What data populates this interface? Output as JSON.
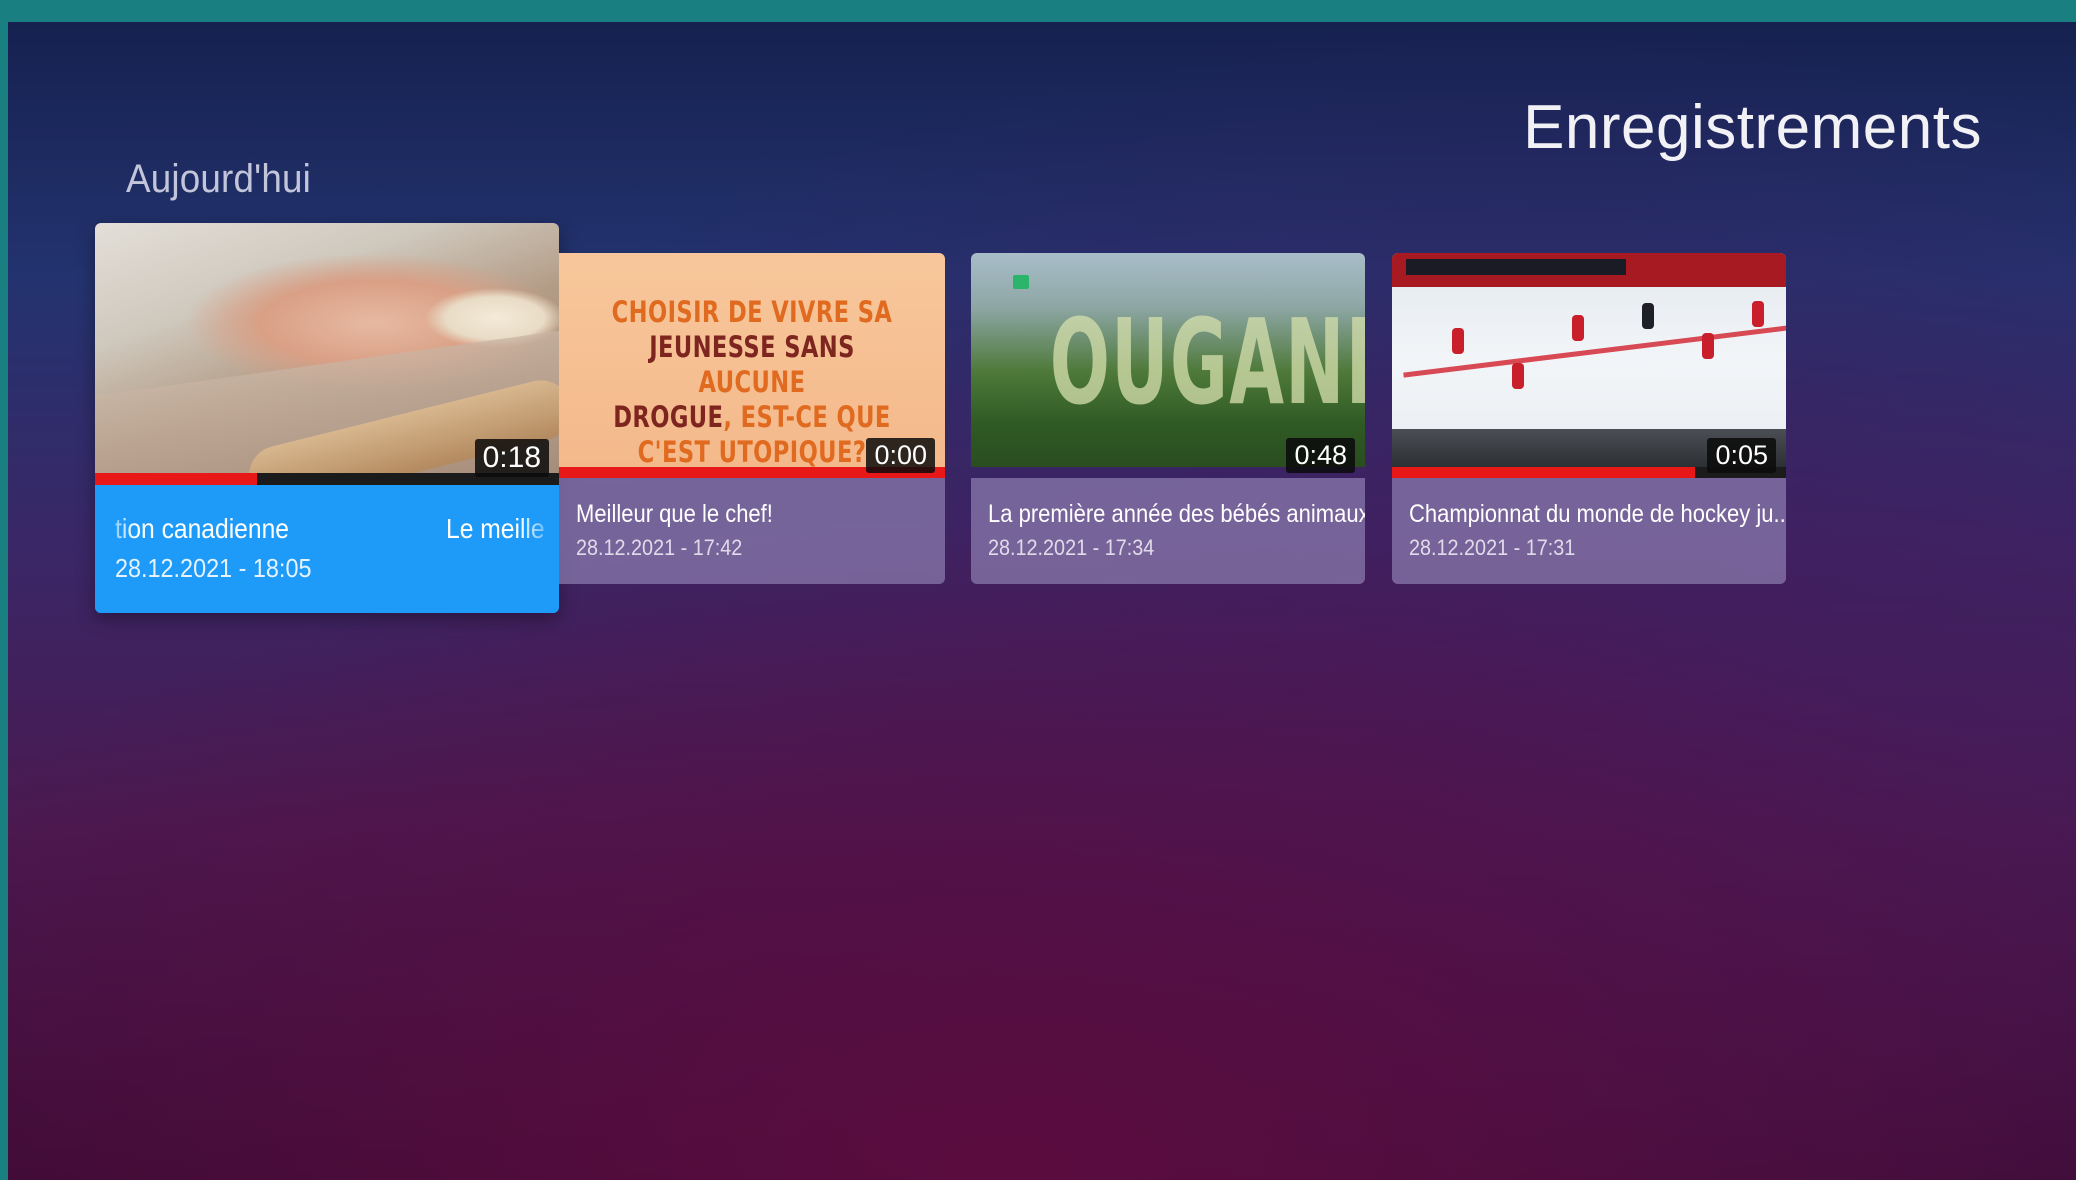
{
  "page": {
    "title": "Enregistrements",
    "section_title": "Aujourd'hui"
  },
  "recordings": [
    {
      "title_left": "tion canadienne",
      "title_right": "Le meille",
      "date": "28.12.2021 - 18:05",
      "duration": "0:18",
      "progress": 0.35,
      "focused": true,
      "thumbnail": "hands-rolling-dough"
    },
    {
      "title": "Meilleur que le chef!",
      "date": "28.12.2021 - 17:42",
      "duration": "0:00",
      "progress": 1.0,
      "thumbnail_text": [
        "CHOISIR DE VIVRE SA",
        "JEUNESSE SANS",
        "AUCUNE",
        "DROGUE",
        ", EST-CE QUE",
        "C'EST UTOPIQUE?"
      ]
    },
    {
      "title": "La première année des bébés animaux",
      "date": "28.12.2021 - 17:34",
      "duration": "0:48",
      "progress": 0.0,
      "thumbnail_text": "OUGANDA"
    },
    {
      "title": "Championnat du monde de hockey ju..",
      "date": "28.12.2021 - 17:31",
      "duration": "0:05",
      "progress": 0.77,
      "thumbnail": "hockey-game"
    }
  ],
  "colors": {
    "focus": "#1e9bf8",
    "progress": "#e81818",
    "card_info": "#8c7daf",
    "frame": "#1a7f80"
  }
}
